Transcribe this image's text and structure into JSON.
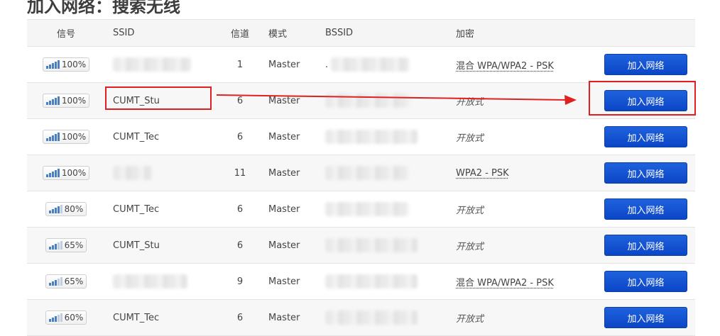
{
  "page_title": "加入网络：搜索无线",
  "headers": {
    "signal": "信号",
    "ssid": "SSID",
    "channel": "信道",
    "mode": "模式",
    "bssid": "BSSID",
    "encryption": "加密"
  },
  "rows": [
    {
      "signal": "100%",
      "ssid": "",
      "channel": "1",
      "mode": "Master",
      "bssid": ".",
      "encryption": "混合 WPA/WPA2 - PSK",
      "button": "加入网络"
    },
    {
      "signal": "100%",
      "ssid": "CUMT_Stu",
      "channel": "6",
      "mode": "Master",
      "bssid": "",
      "encryption": "开放式",
      "button": "加入网络"
    },
    {
      "signal": "100%",
      "ssid": "CUMT_Tec",
      "channel": "6",
      "mode": "Master",
      "bssid": "",
      "encryption": "开放式",
      "button": "加入网络"
    },
    {
      "signal": "100%",
      "ssid": "",
      "channel": "11",
      "mode": "Master",
      "bssid": "",
      "encryption": "WPA2 - PSK",
      "button": "加入网络"
    },
    {
      "signal": "80%",
      "ssid": "CUMT_Tec",
      "channel": "6",
      "mode": "Master",
      "bssid": "",
      "encryption": "开放式",
      "button": "加入网络"
    },
    {
      "signal": "65%",
      "ssid": "CUMT_Stu",
      "channel": "6",
      "mode": "Master",
      "bssid": "",
      "encryption": "开放式",
      "button": "加入网络"
    },
    {
      "signal": "65%",
      "ssid": "",
      "channel": "9",
      "mode": "Master",
      "bssid": "",
      "encryption": "混合 WPA/WPA2 - PSK",
      "button": "加入网络"
    },
    {
      "signal": "60%",
      "ssid": "CUMT_Tec",
      "channel": "6",
      "mode": "Master",
      "bssid": "",
      "encryption": "开放式",
      "button": "加入网络"
    }
  ],
  "colors": {
    "button": "#0b46c6",
    "highlight": "#e02020",
    "signal_bar": "#4a7fc1"
  }
}
